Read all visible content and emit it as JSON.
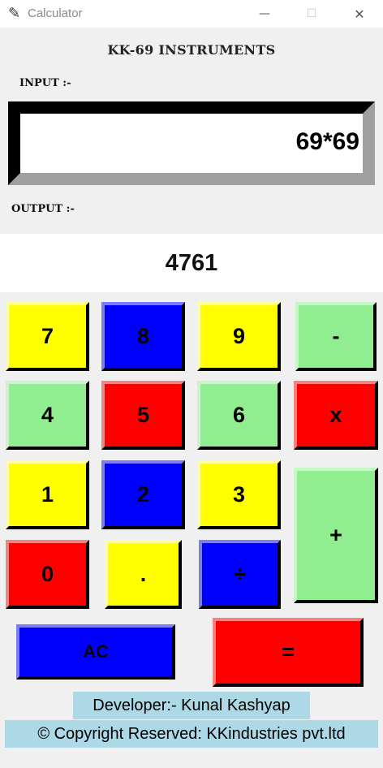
{
  "window": {
    "title": "Calculator",
    "app_icon": "feather-icon",
    "minimize_glyph": "—",
    "maximize_glyph": "☐",
    "close_glyph": "✕"
  },
  "heading": "KK-69 INSTRUMENTS",
  "input": {
    "label": "INPUT :-",
    "value": "69*69"
  },
  "output": {
    "label": "OUTPUT :-",
    "value": "4761"
  },
  "keys": {
    "seven": "7",
    "eight": "8",
    "nine": "9",
    "minus": "-",
    "four": "4",
    "five": "5",
    "six": "6",
    "multiply": "x",
    "one": "1",
    "two": "2",
    "three": "3",
    "plus": "+",
    "zero": "0",
    "dot": ".",
    "divide": "÷",
    "clear": "AC",
    "equals": "="
  },
  "colors": {
    "yellow": "#ffff00",
    "blue": "#0000ff",
    "green": "#90ee90",
    "red": "#ff0000",
    "footer_bg": "#add8e6"
  },
  "footer": {
    "developer": "Developer:- Kunal Kashyap",
    "copyright": "© Copyright Reserved: KKindustries pvt.ltd"
  }
}
